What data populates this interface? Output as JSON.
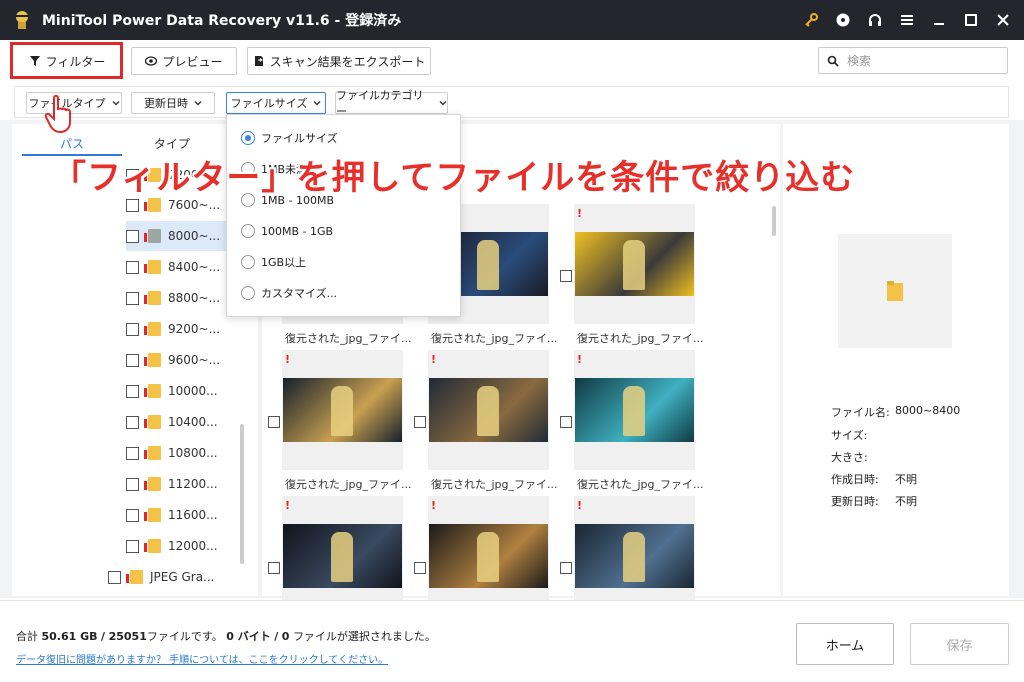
{
  "window": {
    "title": "MiniTool Power Data Recovery v11.6 - 登録済み"
  },
  "toolbar": {
    "filter_label": "フィルター",
    "preview_label": "プレビュー",
    "export_label": "スキャン結果をエクスポート",
    "search_placeholder": "検索"
  },
  "filters": {
    "file_type": "ファイルタイプ",
    "modified_date": "更新日時",
    "file_size": "ファイルサイズ",
    "file_category": "ファイルカテゴリー"
  },
  "size_dropdown": {
    "options": [
      "ファイルサイズ",
      "1MB未満",
      "1MB - 100MB",
      "100MB - 1GB",
      "1GB以上",
      "カスタマイズ..."
    ],
    "selected": "ファイルサイズ"
  },
  "left_tabs": [
    "パス",
    "タイプ"
  ],
  "tree": [
    "7600~...",
    "8000~...",
    "8400~...",
    "8800~...",
    "9200~...",
    "9600~...",
    "10000...",
    "10400...",
    "10800...",
    "11200...",
    "11600...",
    "12000...",
    "JPEG Gra..."
  ],
  "tree_partial_top": "7200~...",
  "thumbnails": {
    "label": "復元された_jpg_ファイ...",
    "mark": "!"
  },
  "details": {
    "file_name_key": "ファイル名:",
    "file_name_value": "8000~8400",
    "size_key": "サイズ:",
    "dimensions_key": "大きさ:",
    "created_key": "作成日時:",
    "created_value": "不明",
    "modified_key": "更新日時:",
    "modified_value": "不明"
  },
  "caption": "「フィルター」を押してファイルを条件で絞り込む",
  "footer": {
    "summary_prefix": "合計",
    "total_size": "50.61 GB",
    "separator": "/",
    "total_files": "25051",
    "summary_mid": "ファイルです。",
    "selected_bytes": "0 バイト",
    "selected_files": "0",
    "summary_suffix": "ファイルが選択されました。",
    "help_link": "データ復旧に問題がありますか？ 手順については、ここをクリックしてください。",
    "home_button": "ホーム",
    "save_button": "保存"
  },
  "colors": {
    "titlebar": "#23262d",
    "accent": "#3c83e6",
    "caption": "#e8302a",
    "highlight_box": "#e02a2a"
  }
}
